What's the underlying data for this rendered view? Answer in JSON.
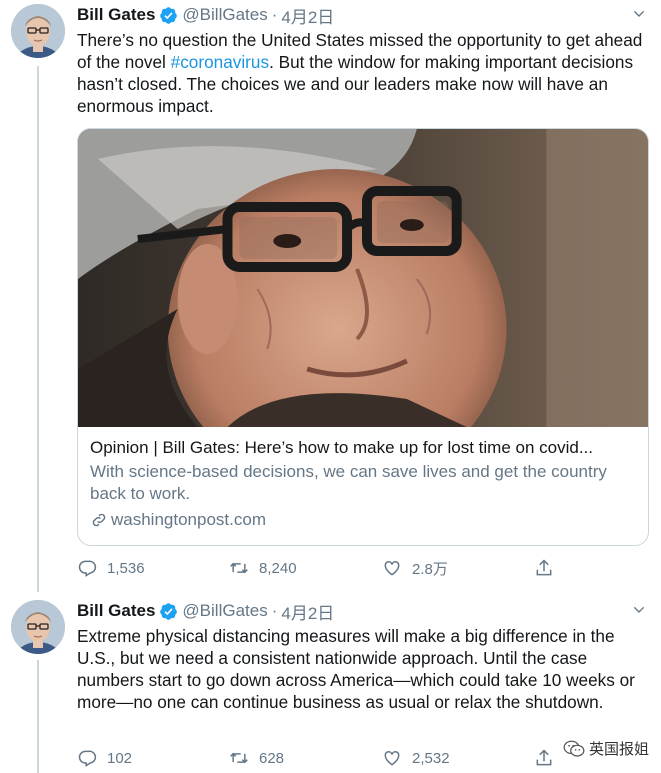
{
  "tweets": [
    {
      "author": {
        "name": "Bill Gates",
        "handle": "@BillGates",
        "date": "4月2日"
      },
      "text_parts": [
        "There’s no question the United States missed the opportunity to get ahead of the novel ",
        "#coronavirus",
        ". But the window for making important decisions hasn’t closed. The choices we and our leaders make now will have an enormous impact."
      ],
      "card": {
        "image": "portrait-photo",
        "title": "Opinion | Bill Gates: Here’s how to make up for lost time on covid...",
        "description": "With science-based decisions, we can save lives and get the country back to work.",
        "domain": "washingtonpost.com"
      },
      "stats": {
        "replies": "1,536",
        "retweets": "8,240",
        "likes": "2.8万"
      }
    },
    {
      "author": {
        "name": "Bill Gates",
        "handle": "@BillGates",
        "date": "4月2日"
      },
      "text": "Extreme physical distancing measures will make a big difference in the U.S., but we need a consistent nationwide approach. Until the case numbers start to go down across America—which could take 10 weeks or more—no one can continue business as usual or relax the shutdown.",
      "stats": {
        "replies": "102",
        "retweets": "628",
        "likes": "2,532"
      }
    }
  ],
  "watermark": {
    "label": "英国报姐"
  },
  "colors": {
    "link": "#1b95e0",
    "secondary": "#657786",
    "verified": "#1da1f2",
    "border": "#ccd6dd"
  },
  "icons": [
    "verified-badge-icon",
    "chevron-down-icon",
    "reply-icon",
    "retweet-icon",
    "like-icon",
    "share-icon",
    "link-icon",
    "wechat-icon"
  ]
}
